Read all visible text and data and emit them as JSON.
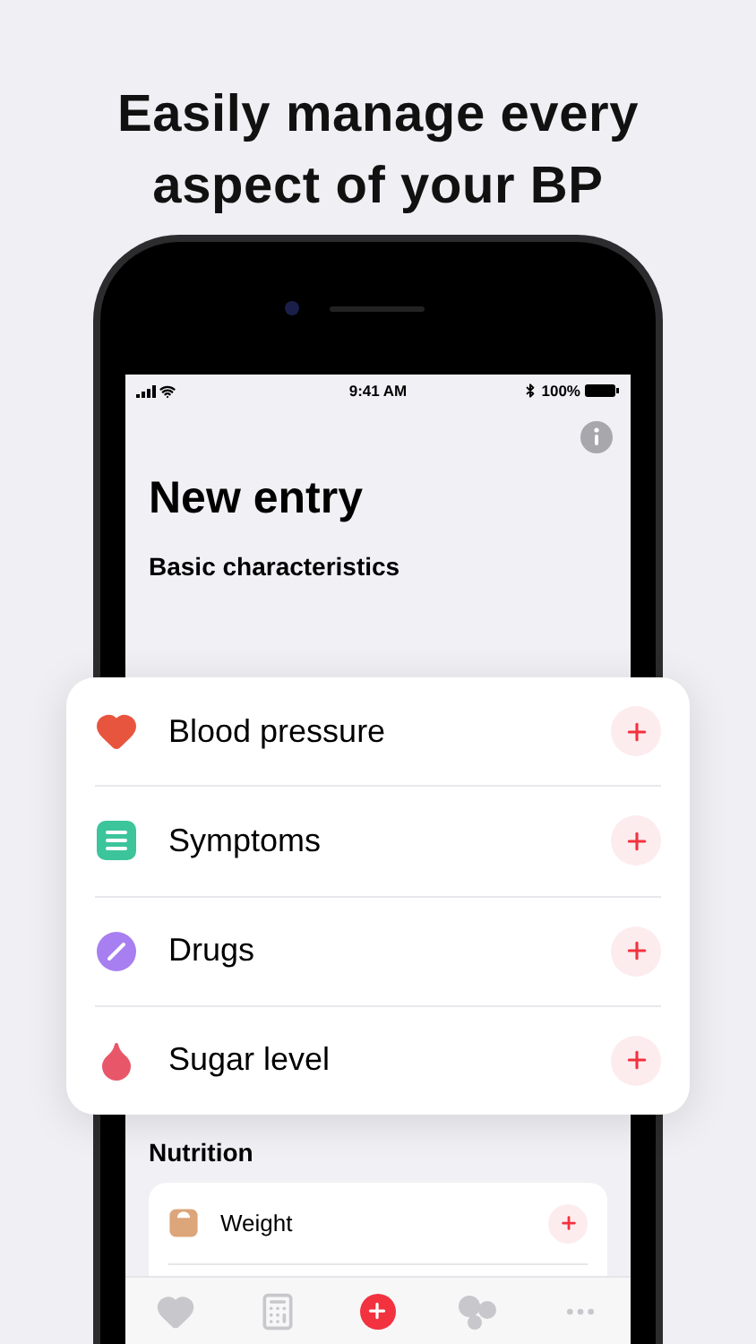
{
  "headline": "Easily manage every aspect of your BP",
  "status_bar": {
    "time": "9:41 AM",
    "battery": "100%"
  },
  "screen": {
    "title": "New entry",
    "section": "Basic characteristics",
    "categories": [
      {
        "kind": "heart",
        "label": "Blood pressure"
      },
      {
        "kind": "list",
        "label": "Symptoms"
      },
      {
        "kind": "pill",
        "label": "Drugs"
      },
      {
        "kind": "drop",
        "label": "Sugar level"
      }
    ],
    "nutrition": {
      "title": "Nutrition",
      "items": [
        {
          "kind": "scale",
          "label": "Weight"
        }
      ]
    },
    "tab_bar": [
      {
        "kind": "heart"
      },
      {
        "kind": "calculator"
      },
      {
        "kind": "add"
      },
      {
        "kind": "bubbles"
      },
      {
        "kind": "more"
      }
    ]
  }
}
